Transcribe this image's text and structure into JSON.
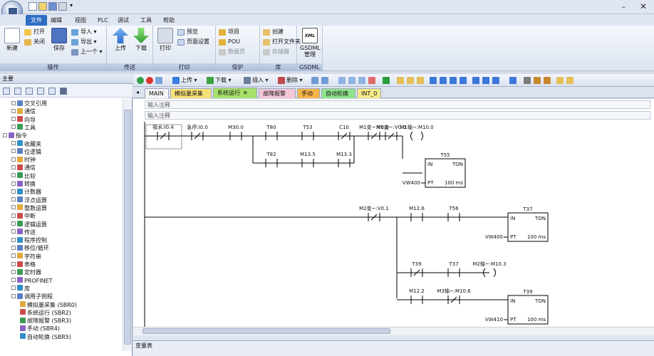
{
  "window": {
    "quick_access": [
      "new-icon",
      "open-icon",
      "save-icon",
      "print-icon",
      "dropdown-icon"
    ]
  },
  "ribbon_tabs": [
    "文件",
    "编辑",
    "视图",
    "PLC",
    "调试",
    "工具",
    "帮助"
  ],
  "ribbon": {
    "groups": [
      {
        "label": "操作",
        "big": [
          {
            "label": "新建",
            "icon": "new-project-icon"
          },
          {
            "label": "保存",
            "icon": "save-icon"
          }
        ],
        "small": [
          {
            "label": "打开",
            "icon": "open-folder-icon"
          },
          {
            "label": "关闭",
            "icon": "close-folder-icon"
          },
          {
            "label": "导入",
            "icon": "import-icon"
          },
          {
            "label": "导出",
            "icon": "export-icon"
          },
          {
            "label": "上一个",
            "icon": "previous-icon"
          }
        ]
      },
      {
        "label": "传送",
        "big": [
          {
            "label": "上传",
            "icon": "upload-icon"
          },
          {
            "label": "下载",
            "icon": "download-icon"
          }
        ]
      },
      {
        "label": "打印",
        "big": [
          {
            "label": "打印",
            "icon": "printer-icon"
          }
        ],
        "small": [
          {
            "label": "预览",
            "icon": "preview-icon"
          },
          {
            "label": "页面设置",
            "icon": "page-setup-icon"
          }
        ]
      },
      {
        "label": "保护",
        "small": [
          {
            "label": "项目",
            "icon": "project-lock-icon"
          },
          {
            "label": "POU",
            "icon": "pou-lock-icon"
          },
          {
            "label": "数据页",
            "icon": "data-page-lock-icon"
          }
        ]
      },
      {
        "label": "库",
        "small": [
          {
            "label": "创建",
            "icon": "create-library-icon"
          },
          {
            "label": "打开文件夹",
            "icon": "open-library-folder-icon"
          },
          {
            "label": "存储器",
            "icon": "memory-icon"
          }
        ]
      },
      {
        "label": "GSDML",
        "big": [
          {
            "label": "GSDML\n管理",
            "icon": "xml-icon"
          }
        ]
      }
    ]
  },
  "left_panel": {
    "title": "主要",
    "tree": [
      {
        "label": "交叉引用",
        "level": 1
      },
      {
        "label": "通信",
        "level": 1
      },
      {
        "label": "向导",
        "level": 1
      },
      {
        "label": "工具",
        "level": 1
      },
      {
        "label": "指令",
        "level": 0
      },
      {
        "label": "收藏夹",
        "level": 1
      },
      {
        "label": "位逻辑",
        "level": 1
      },
      {
        "label": "时钟",
        "level": 1
      },
      {
        "label": "通信",
        "level": 1
      },
      {
        "label": "比较",
        "level": 1
      },
      {
        "label": "转换",
        "level": 1
      },
      {
        "label": "计数器",
        "level": 1
      },
      {
        "label": "浮点运算",
        "level": 1
      },
      {
        "label": "整数运算",
        "level": 1
      },
      {
        "label": "中断",
        "level": 1
      },
      {
        "label": "逻辑运算",
        "level": 1
      },
      {
        "label": "传送",
        "level": 1
      },
      {
        "label": "程序控制",
        "level": 1
      },
      {
        "label": "移位/循环",
        "level": 1
      },
      {
        "label": "字符串",
        "level": 1
      },
      {
        "label": "表格",
        "level": 1
      },
      {
        "label": "定时器",
        "level": 1
      },
      {
        "label": "PROFINET",
        "level": 1
      },
      {
        "label": "库",
        "level": 1
      },
      {
        "label": "调用子例程",
        "level": 1
      },
      {
        "label": "模拟量采集 (SBR0)",
        "level": 2
      },
      {
        "label": "系统运行 (SBR2)",
        "level": 2
      },
      {
        "label": "故障报警 (SBR3)",
        "level": 2
      },
      {
        "label": "手动 (SBR4)",
        "level": 2
      },
      {
        "label": "自动轮换 (SBR5)",
        "level": 2
      }
    ]
  },
  "editor_toolbar": {
    "upload": "上传",
    "download": "下载",
    "insert": "插入",
    "delete": "删除"
  },
  "pou_tabs": [
    {
      "label": "MAIN",
      "color": "#f4f4f4"
    },
    {
      "label": "模拟量采集",
      "color": "#f7e27a"
    },
    {
      "label": "系统运行",
      "color": "#a6e06a",
      "active": true,
      "close": "✕"
    },
    {
      "label": "故障报警",
      "color": "#f4c8d8"
    },
    {
      "label": "手动",
      "color": "#f7b44a"
    },
    {
      "label": "自动轮换",
      "color": "#8fe38a"
    },
    {
      "label": "INT_0",
      "color": "#f5ea8a"
    }
  ],
  "ladder": {
    "comment1": "输入注释",
    "comment2": "输入注释",
    "contacts": [
      {
        "label": "吸水:I0.4",
        "type": "NC"
      },
      {
        "label": "急停:I0.0",
        "type": "NC"
      },
      {
        "label": "M30.0",
        "type": "NO"
      },
      {
        "label": "T80",
        "type": "NO"
      },
      {
        "label": "T53",
        "type": "NO"
      },
      {
        "label": "C10",
        "type": "NC"
      },
      {
        "label": "M1变~:V0.0",
        "type": "NC"
      },
      {
        "label": "T82",
        "type": "NO"
      },
      {
        "label": "M13.5",
        "type": "NO"
      },
      {
        "label": "M13.3",
        "type": "NO"
      },
      {
        "label": "M2变~:V0.1",
        "type": "NC"
      },
      {
        "label": "M12.6",
        "type": "NO"
      },
      {
        "label": "T56",
        "type": "NO"
      },
      {
        "label": "T39",
        "type": "NC"
      },
      {
        "label": "T37",
        "type": "NO"
      },
      {
        "label": "M12.2",
        "type": "NO"
      },
      {
        "label": "M3轴~:M10.6",
        "type": "NC"
      }
    ],
    "coils": [
      {
        "label": "M1轴~:M10.0"
      },
      {
        "label": "M2轴~:M10.3"
      }
    ],
    "timers": [
      {
        "name": "T55",
        "in": "IN",
        "type": "TON",
        "pt_var": "VW400",
        "pt": "PT",
        "base": "100 ms"
      },
      {
        "name": "T37",
        "in": "IN",
        "type": "TON",
        "pt_var": "VW400",
        "pt": "PT",
        "base": "100 ms"
      },
      {
        "name": "T39",
        "in": "IN",
        "type": "TON",
        "pt_var": "VW410",
        "pt": "PT",
        "base": "100 ms"
      }
    ]
  },
  "bottom_panel": {
    "title": "变量表"
  }
}
